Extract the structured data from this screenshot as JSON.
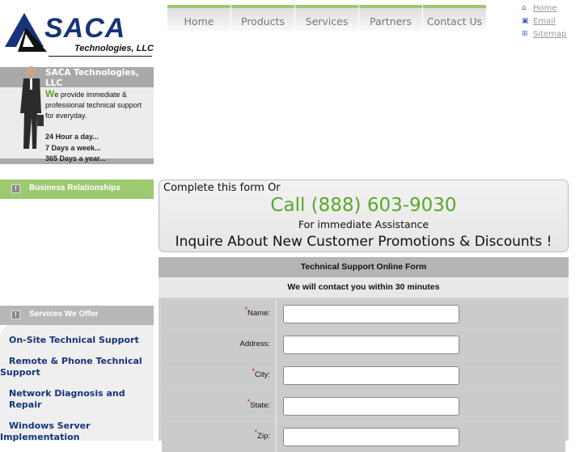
{
  "logo": {
    "name": "SACA",
    "sub": "Technologies, LLC"
  },
  "nav": [
    "Home",
    "Products",
    "Services",
    "Partners",
    "Contact Us"
  ],
  "top_links": [
    {
      "icon": "home-icon",
      "label": "Home"
    },
    {
      "icon": "email-icon",
      "label": "Email"
    },
    {
      "icon": "sitemap-icon",
      "label": "Sitemap"
    }
  ],
  "profile": {
    "title": "SACA Technologies, LLC",
    "initial": "W",
    "text": "e provide immediate & professional technical support for everyday.",
    "hours": [
      "24 Hour a day...",
      "7 Days a week...",
      "365 Days a year..."
    ]
  },
  "sidebar": {
    "business_title": "Business Relationships",
    "services_title": "Services We Offer",
    "services": [
      "On-Site Technical Support",
      "Remote & Phone Technical Support",
      "Network Diagnosis and Repair",
      "Windows Server Implementation"
    ]
  },
  "callbox": {
    "intro": "Complete this form Or",
    "phone": "Call (888) 603-9030",
    "sub": "For immediate Assistance",
    "promo": "Inquire About New Customer Promotions & Discounts !"
  },
  "form": {
    "title": "Technical Support Online Form",
    "subtitle": "We will contact you within 30 minutes",
    "fields": [
      {
        "label": "Name:",
        "required": "*"
      },
      {
        "label": "Address:",
        "required": ""
      },
      {
        "label": "City:",
        "required": "*"
      },
      {
        "label": "State:",
        "required": "*"
      },
      {
        "label": "Zip:",
        "required": "*"
      }
    ]
  },
  "colors": {
    "brand_blue": "#17347a",
    "accent_green": "#9dc96f",
    "phone_green": "#5aa72a"
  }
}
